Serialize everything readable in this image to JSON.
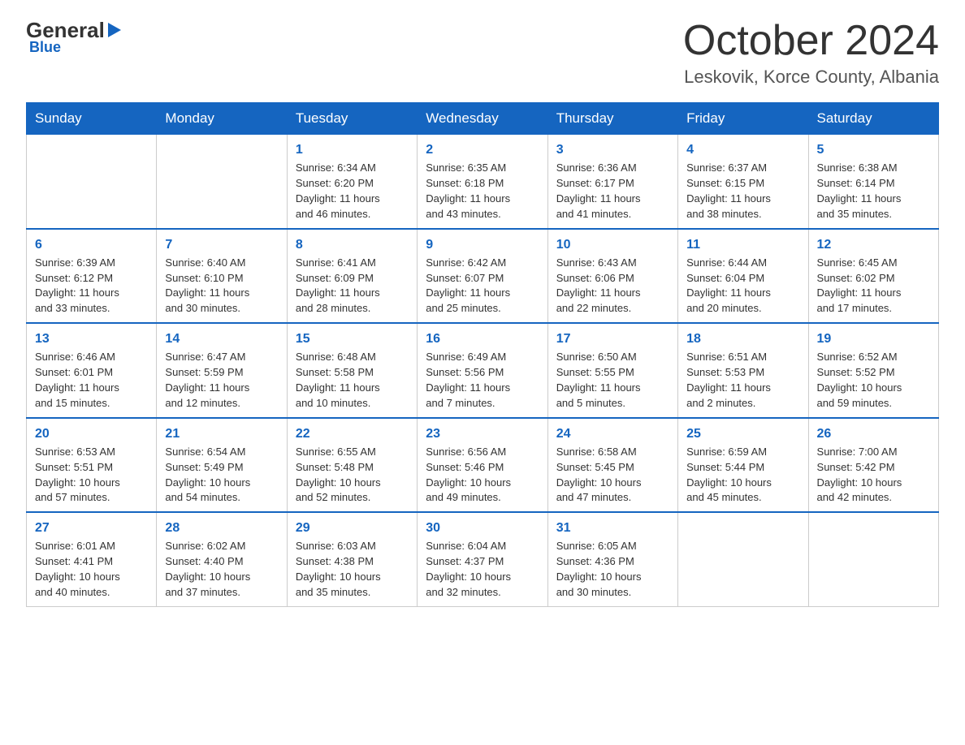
{
  "header": {
    "logo_general": "General",
    "logo_blue": "Blue",
    "month_title": "October 2024",
    "location": "Leskovik, Korce County, Albania"
  },
  "weekdays": [
    "Sunday",
    "Monday",
    "Tuesday",
    "Wednesday",
    "Thursday",
    "Friday",
    "Saturday"
  ],
  "weeks": [
    [
      {
        "day": "",
        "info": ""
      },
      {
        "day": "",
        "info": ""
      },
      {
        "day": "1",
        "info": "Sunrise: 6:34 AM\nSunset: 6:20 PM\nDaylight: 11 hours\nand 46 minutes."
      },
      {
        "day": "2",
        "info": "Sunrise: 6:35 AM\nSunset: 6:18 PM\nDaylight: 11 hours\nand 43 minutes."
      },
      {
        "day": "3",
        "info": "Sunrise: 6:36 AM\nSunset: 6:17 PM\nDaylight: 11 hours\nand 41 minutes."
      },
      {
        "day": "4",
        "info": "Sunrise: 6:37 AM\nSunset: 6:15 PM\nDaylight: 11 hours\nand 38 minutes."
      },
      {
        "day": "5",
        "info": "Sunrise: 6:38 AM\nSunset: 6:14 PM\nDaylight: 11 hours\nand 35 minutes."
      }
    ],
    [
      {
        "day": "6",
        "info": "Sunrise: 6:39 AM\nSunset: 6:12 PM\nDaylight: 11 hours\nand 33 minutes."
      },
      {
        "day": "7",
        "info": "Sunrise: 6:40 AM\nSunset: 6:10 PM\nDaylight: 11 hours\nand 30 minutes."
      },
      {
        "day": "8",
        "info": "Sunrise: 6:41 AM\nSunset: 6:09 PM\nDaylight: 11 hours\nand 28 minutes."
      },
      {
        "day": "9",
        "info": "Sunrise: 6:42 AM\nSunset: 6:07 PM\nDaylight: 11 hours\nand 25 minutes."
      },
      {
        "day": "10",
        "info": "Sunrise: 6:43 AM\nSunset: 6:06 PM\nDaylight: 11 hours\nand 22 minutes."
      },
      {
        "day": "11",
        "info": "Sunrise: 6:44 AM\nSunset: 6:04 PM\nDaylight: 11 hours\nand 20 minutes."
      },
      {
        "day": "12",
        "info": "Sunrise: 6:45 AM\nSunset: 6:02 PM\nDaylight: 11 hours\nand 17 minutes."
      }
    ],
    [
      {
        "day": "13",
        "info": "Sunrise: 6:46 AM\nSunset: 6:01 PM\nDaylight: 11 hours\nand 15 minutes."
      },
      {
        "day": "14",
        "info": "Sunrise: 6:47 AM\nSunset: 5:59 PM\nDaylight: 11 hours\nand 12 minutes."
      },
      {
        "day": "15",
        "info": "Sunrise: 6:48 AM\nSunset: 5:58 PM\nDaylight: 11 hours\nand 10 minutes."
      },
      {
        "day": "16",
        "info": "Sunrise: 6:49 AM\nSunset: 5:56 PM\nDaylight: 11 hours\nand 7 minutes."
      },
      {
        "day": "17",
        "info": "Sunrise: 6:50 AM\nSunset: 5:55 PM\nDaylight: 11 hours\nand 5 minutes."
      },
      {
        "day": "18",
        "info": "Sunrise: 6:51 AM\nSunset: 5:53 PM\nDaylight: 11 hours\nand 2 minutes."
      },
      {
        "day": "19",
        "info": "Sunrise: 6:52 AM\nSunset: 5:52 PM\nDaylight: 10 hours\nand 59 minutes."
      }
    ],
    [
      {
        "day": "20",
        "info": "Sunrise: 6:53 AM\nSunset: 5:51 PM\nDaylight: 10 hours\nand 57 minutes."
      },
      {
        "day": "21",
        "info": "Sunrise: 6:54 AM\nSunset: 5:49 PM\nDaylight: 10 hours\nand 54 minutes."
      },
      {
        "day": "22",
        "info": "Sunrise: 6:55 AM\nSunset: 5:48 PM\nDaylight: 10 hours\nand 52 minutes."
      },
      {
        "day": "23",
        "info": "Sunrise: 6:56 AM\nSunset: 5:46 PM\nDaylight: 10 hours\nand 49 minutes."
      },
      {
        "day": "24",
        "info": "Sunrise: 6:58 AM\nSunset: 5:45 PM\nDaylight: 10 hours\nand 47 minutes."
      },
      {
        "day": "25",
        "info": "Sunrise: 6:59 AM\nSunset: 5:44 PM\nDaylight: 10 hours\nand 45 minutes."
      },
      {
        "day": "26",
        "info": "Sunrise: 7:00 AM\nSunset: 5:42 PM\nDaylight: 10 hours\nand 42 minutes."
      }
    ],
    [
      {
        "day": "27",
        "info": "Sunrise: 6:01 AM\nSunset: 4:41 PM\nDaylight: 10 hours\nand 40 minutes."
      },
      {
        "day": "28",
        "info": "Sunrise: 6:02 AM\nSunset: 4:40 PM\nDaylight: 10 hours\nand 37 minutes."
      },
      {
        "day": "29",
        "info": "Sunrise: 6:03 AM\nSunset: 4:38 PM\nDaylight: 10 hours\nand 35 minutes."
      },
      {
        "day": "30",
        "info": "Sunrise: 6:04 AM\nSunset: 4:37 PM\nDaylight: 10 hours\nand 32 minutes."
      },
      {
        "day": "31",
        "info": "Sunrise: 6:05 AM\nSunset: 4:36 PM\nDaylight: 10 hours\nand 30 minutes."
      },
      {
        "day": "",
        "info": ""
      },
      {
        "day": "",
        "info": ""
      }
    ]
  ]
}
